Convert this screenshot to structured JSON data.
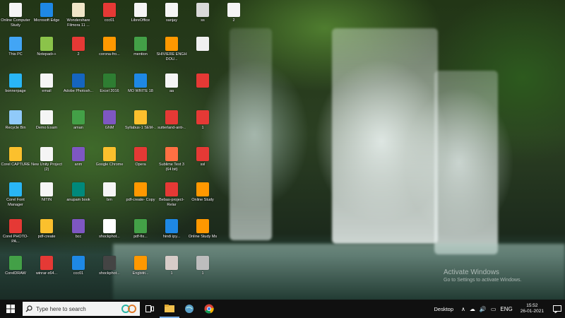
{
  "desktop": {
    "icons": [
      {
        "label": "Online Computer Study",
        "color": "#f5f5f5"
      },
      {
        "label": "Microsoft Edge",
        "color": "#1e88e5"
      },
      {
        "label": "Wondershare Filmora 11 ...",
        "color": "#f0e6c8"
      },
      {
        "label": "ccc01",
        "color": "#e53935"
      },
      {
        "label": "LibreOffice",
        "color": "#f5f5f5"
      },
      {
        "label": "sanjay",
        "color": "#f5f5f5"
      },
      {
        "label": "ss",
        "color": "#d9d9d9"
      },
      {
        "label": "2",
        "color": "#f5f5f5"
      },
      {
        "label": "This PC",
        "color": "#42a5f5"
      },
      {
        "label": "Notepad++",
        "color": "#8bc34a"
      },
      {
        "label": "2",
        "color": "#e53935"
      },
      {
        "label": "corona-fro...",
        "color": "#ff9800"
      },
      {
        "label": "mention",
        "color": "#43a047"
      },
      {
        "label": "SHIVIERE ENGH DOU...",
        "color": "#ff9800"
      },
      {
        "label": "",
        "color": "#f0f0f0"
      },
      {
        "label": "bonnerpage",
        "color": "#29b6f6"
      },
      {
        "label": "email",
        "color": "#f5f5f5"
      },
      {
        "label": "Adobe Photosh...",
        "color": "#1565c0"
      },
      {
        "label": "Excel 2016",
        "color": "#2e7d32"
      },
      {
        "label": "MO WRITE 18",
        "color": "#1e88e5"
      },
      {
        "label": "aa",
        "color": "#f5f5f5"
      },
      {
        "label": "",
        "color": "#e53935"
      },
      {
        "label": "Recycle Bin",
        "color": "#90caf9"
      },
      {
        "label": "Demo Exam",
        "color": "#f5f5f5"
      },
      {
        "label": "aman",
        "color": "#43a047"
      },
      {
        "label": "GNM",
        "color": "#7e57c2"
      },
      {
        "label": "Syllabus-1 SEM-..",
        "color": "#fbc02d"
      },
      {
        "label": "sutterland-anti-..",
        "color": "#e53935"
      },
      {
        "label": "1",
        "color": "#e53935"
      },
      {
        "label": "Corel CAPTURE",
        "color": "#fbc02d"
      },
      {
        "label": "New Unity Project (2)",
        "color": "#f5f5f5"
      },
      {
        "label": "anm",
        "color": "#7e57c2"
      },
      {
        "label": "Google Chrome",
        "color": "#fbc02d"
      },
      {
        "label": "Opera",
        "color": "#e53935"
      },
      {
        "label": "Sublime Text 3 (64 bit)",
        "color": "#ff7043"
      },
      {
        "label": "ssl",
        "color": "#e53935"
      },
      {
        "label": "Corel Font Manager",
        "color": "#29b6f6"
      },
      {
        "label": "NITIN",
        "color": "#f5f5f5"
      },
      {
        "label": "anupam book",
        "color": "#00897b"
      },
      {
        "label": "bm",
        "color": "#f5f5f5"
      },
      {
        "label": "pdf-create- Copy",
        "color": "#ff9800"
      },
      {
        "label": "Bebas-project-Relar",
        "color": "#e53935"
      },
      {
        "label": "Online Study",
        "color": "#ff9800"
      },
      {
        "label": "Corel PHOTO-PA...",
        "color": "#e53935"
      },
      {
        "label": "pdf-create",
        "color": "#fbc02d"
      },
      {
        "label": "bcc",
        "color": "#7e57c2"
      },
      {
        "label": "shockphot...",
        "color": "#ffffff"
      },
      {
        "label": "pdf-fix...",
        "color": "#43a047"
      },
      {
        "label": "hindi ipy...",
        "color": "#1e88e5"
      },
      {
        "label": "Online Study Ms",
        "color": "#ff9800"
      },
      {
        "label": "CorelDRAW",
        "color": "#43a047"
      },
      {
        "label": "winrar-x64...",
        "color": "#e53935"
      },
      {
        "label": "ccc01",
        "color": "#1e88e5"
      },
      {
        "label": "shockphot...",
        "color": "#444444"
      },
      {
        "label": "Engbitit...",
        "color": "#ff9800"
      },
      {
        "label": "1",
        "color": "#d7ccc8"
      },
      {
        "label": "1",
        "color": "#bdbdbd"
      }
    ]
  },
  "watermark": {
    "title": "Activate Windows",
    "subtitle": "Go to Settings to activate Windows."
  },
  "taskbar": {
    "search_placeholder": "Type here to search",
    "tray": {
      "desktop_label": "Desktop",
      "language": "ENG",
      "time": "15:52",
      "date": "26-01-2021"
    }
  }
}
